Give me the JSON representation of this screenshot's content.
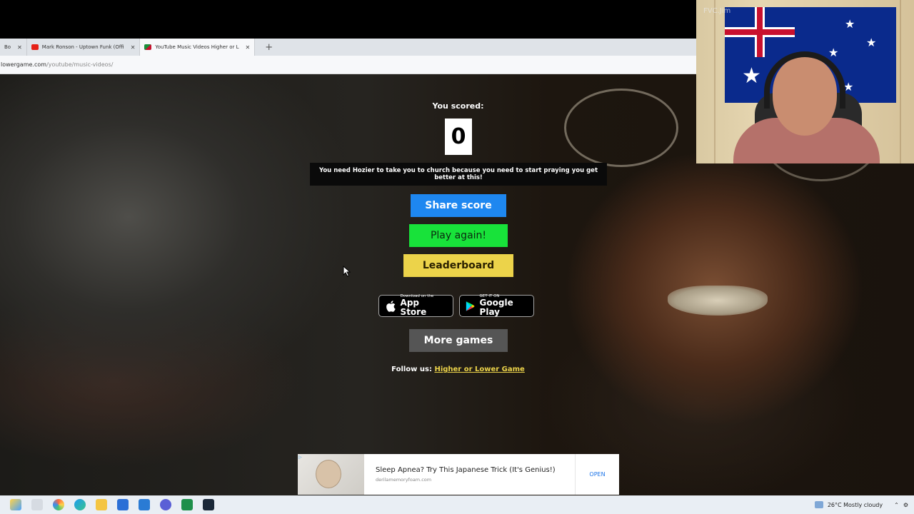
{
  "browser": {
    "tabs": [
      {
        "label": "Bo",
        "favicon": "tab-favicon-icon"
      },
      {
        "label": "Mark Ronson - Uptown Funk (Offi",
        "favicon": "youtube-icon"
      },
      {
        "label": "YouTube Music Videos Higher or L",
        "favicon": "game-icon"
      }
    ],
    "new_tab": "+",
    "close": "✕",
    "address": {
      "host": "lowergame.com",
      "path": "/youtube/music-videos/"
    }
  },
  "game": {
    "scored_label": "You scored:",
    "score": "0",
    "message": "You need Hozier to take you to church because you need to start praying you get better at this!",
    "share_label": "Share score",
    "play_label": "Play again!",
    "leaderboard_label": "Leaderboard",
    "appstore": {
      "small": "Download on the",
      "big": "App Store"
    },
    "googleplay": {
      "small": "GET IT ON",
      "big": "Google Play"
    },
    "more_games_label": "More games",
    "follow_label": "Follow us:",
    "follow_link": "Higher or Lower Game"
  },
  "webcam": {
    "label": "FVC.Jim"
  },
  "ad": {
    "title": "Sleep Apnea? Try This Japanese Trick (It's Genius!)",
    "domain": "derilamemoryfoam.com",
    "open_label": "OPEN"
  },
  "taskbar": {
    "weather": "26°C  Mostly cloudy"
  },
  "colors": {
    "share": "#1e87f0",
    "play": "#18e23a",
    "leaderboard": "#ecd34a",
    "more": "#555555"
  }
}
